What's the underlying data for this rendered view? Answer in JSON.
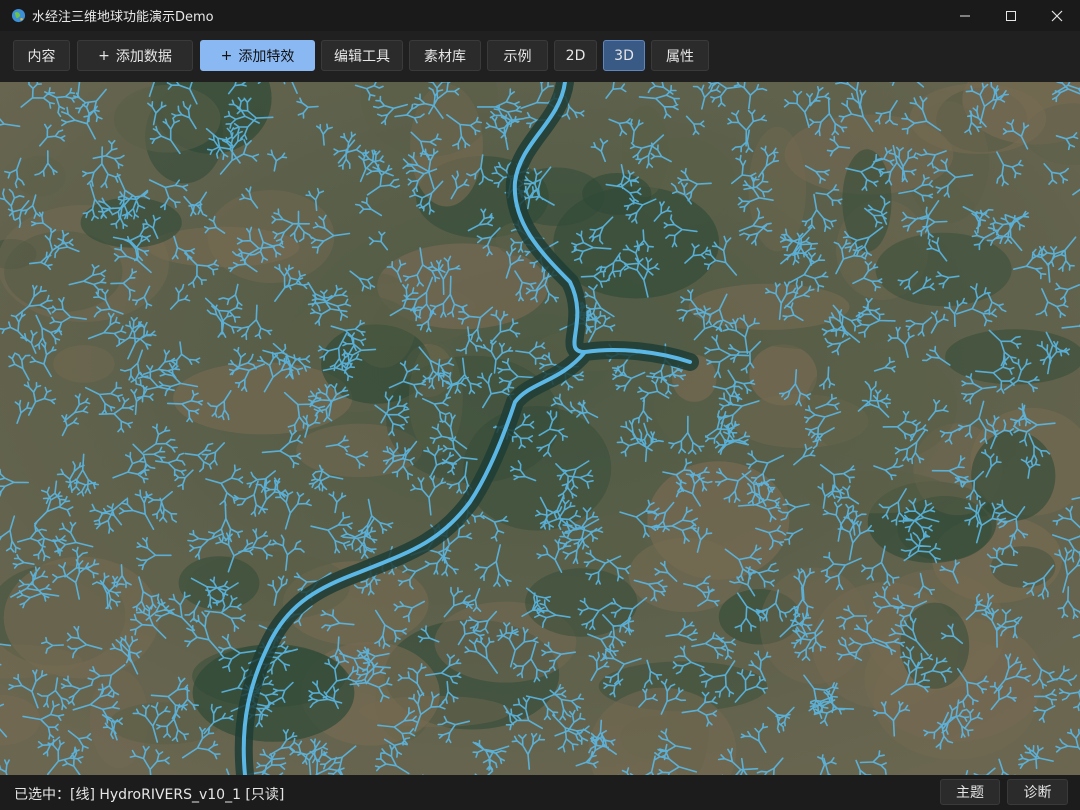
{
  "window": {
    "title": "水经注三维地球功能演示Demo",
    "controls": [
      "minimize-icon",
      "maximize-icon",
      "close-icon"
    ]
  },
  "toolbar": {
    "content": "内容",
    "add_data": "添加数据",
    "add_effect": "添加特效",
    "edit_tools": "编辑工具",
    "material_library": "素材库",
    "examples": "示例",
    "mode_2d": "2D",
    "mode_3d": "3D",
    "properties": "属性",
    "active_mode": "3D",
    "plus_symbol": "+"
  },
  "map": {
    "layer": "HydroRIVERS_v10_1",
    "river_color": "#5bb8e6",
    "terrain_colors": [
      "#5a5f47",
      "#2f4a37",
      "#766a52"
    ]
  },
  "status": {
    "text": "已选中：[线] HydroRIVERS_v10_1 [只读]",
    "theme_button": "主题",
    "diagnose_button": "诊断"
  }
}
